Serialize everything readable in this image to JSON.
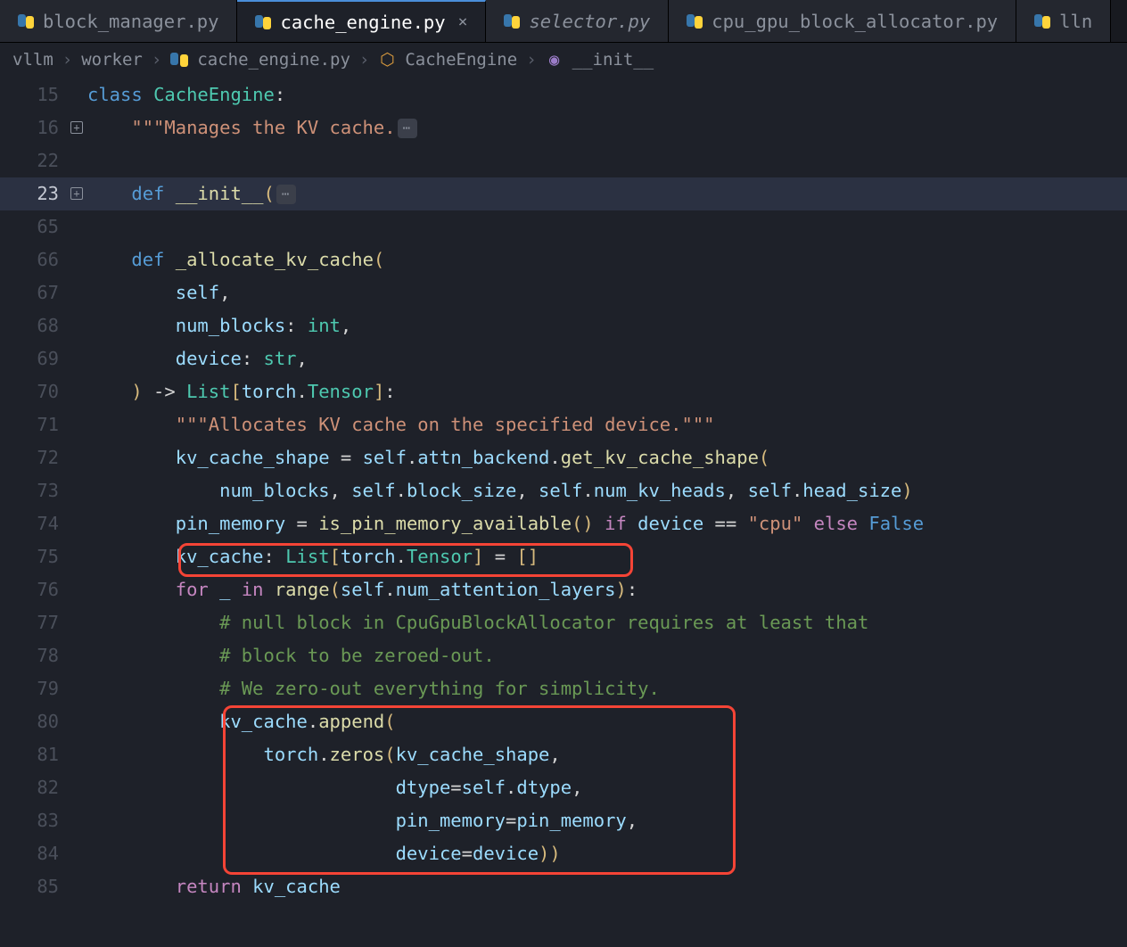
{
  "tabs": [
    {
      "label": "block_manager.py"
    },
    {
      "label": "cache_engine.py",
      "active": true,
      "close": "×"
    },
    {
      "label": "selector.py",
      "italic": true
    },
    {
      "label": "cpu_gpu_block_allocator.py"
    },
    {
      "label": "lln"
    }
  ],
  "breadcrumbs": {
    "parts": [
      "vllm",
      "worker",
      "cache_engine.py",
      "CacheEngine",
      "__init__"
    ],
    "sep": "›"
  },
  "lines": {
    "l15": {
      "num": "15",
      "class_kw": "class",
      "class_name": "CacheEngine",
      "colon": ":"
    },
    "l16": {
      "num": "16",
      "docstring": "\"\"\"Manages the KV cache."
    },
    "l22": {
      "num": "22"
    },
    "l23": {
      "num": "23",
      "def": "def",
      "fn": "__init__",
      "paren": "("
    },
    "l65": {
      "num": "65"
    },
    "l66": {
      "num": "66",
      "def": "def",
      "fn": "_allocate_kv_cache",
      "paren": "("
    },
    "l67": {
      "num": "67",
      "self": "self",
      "comma": ","
    },
    "l68": {
      "num": "68",
      "param": "num_blocks",
      "type": "int",
      "comma": ","
    },
    "l69": {
      "num": "69",
      "param": "device",
      "type": "str",
      "comma": ","
    },
    "l70": {
      "num": "70",
      "close": ")",
      "arrow": " -> ",
      "list": "List",
      "lb": "[",
      "torch": "torch",
      "dot": ".",
      "tensor": "Tensor",
      "rb": "]",
      "colon": ":"
    },
    "l71": {
      "num": "71",
      "doc": "\"\"\"Allocates KV cache on the specified device.\"\"\""
    },
    "l72": {
      "num": "72",
      "var": "kv_cache_shape",
      "eq": " = ",
      "self": "self",
      "attn": "attn_backend",
      "fn": "get_kv_cache_shape",
      "paren": "("
    },
    "l73": {
      "num": "73",
      "a1": "num_blocks",
      "self1": "self",
      "p1": "block_size",
      "self2": "self",
      "p2": "num_kv_heads",
      "self3": "self",
      "p3": "head_size",
      "close": ")"
    },
    "l74": {
      "num": "74",
      "var": "pin_memory",
      "eq": " = ",
      "fn": "is_pin_memory_available",
      "if_": " if ",
      "dev": "device",
      "eqeq": " == ",
      "cpu": "\"cpu\"",
      "else_": " else ",
      "false_": "False"
    },
    "l75": {
      "num": "75",
      "var": "kv_cache",
      "list": "List",
      "torch": "torch",
      "tensor": "Tensor",
      "eq": " = ",
      "empty": "[]"
    },
    "l76": {
      "num": "76",
      "for_": "for",
      "under": "_",
      "in_": "in",
      "range": "range",
      "self": "self",
      "attr": "num_attention_layers"
    },
    "l77": {
      "num": "77",
      "cmt": "# null block in CpuGpuBlockAllocator requires at least that"
    },
    "l78": {
      "num": "78",
      "cmt": "# block to be zeroed-out."
    },
    "l79": {
      "num": "79",
      "cmt": "# We zero-out everything for simplicity."
    },
    "l80": {
      "num": "80",
      "var": "kv_cache",
      "fn": "append",
      "paren": "("
    },
    "l81": {
      "num": "81",
      "torch": "torch",
      "fn": "zeros",
      "arg": "kv_cache_shape"
    },
    "l82": {
      "num": "82",
      "kw": "dtype",
      "self": "self",
      "attr": "dtype"
    },
    "l83": {
      "num": "83",
      "kw": "pin_memory",
      "val": "pin_memory"
    },
    "l84": {
      "num": "84",
      "kw": "device",
      "val": "device",
      "close": "))"
    },
    "l85": {
      "num": "85",
      "ret": "return",
      "var": "kv_cache"
    }
  }
}
